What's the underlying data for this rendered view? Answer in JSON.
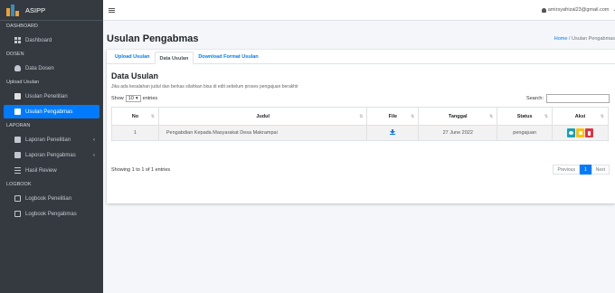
{
  "brand": {
    "name": "ASIPP"
  },
  "sidebar": {
    "sections": [
      {
        "header": "DASHBOARD",
        "items": [
          {
            "label": "Dashboard",
            "icon": "grid-icon"
          }
        ]
      },
      {
        "header": "DOSEN",
        "items": [
          {
            "label": "Data Dosen",
            "icon": "users-icon"
          }
        ]
      },
      {
        "header": "Upload Usulan",
        "items": [
          {
            "label": "Usulan Penelitian",
            "icon": "file-icon"
          },
          {
            "label": "Usulan Pengabmas",
            "icon": "file-icon",
            "active": true
          }
        ]
      },
      {
        "header": "LAPORAN",
        "items": [
          {
            "label": "Laporan Penelitian",
            "icon": "check-square-icon"
          },
          {
            "label": "Laporan Pengabmas",
            "icon": "check-square-icon"
          },
          {
            "label": "Hasil Review",
            "icon": "list-icon"
          }
        ]
      },
      {
        "header": "LOGBOOK",
        "items": [
          {
            "label": "Logbook Penelitian",
            "icon": "edit-icon"
          },
          {
            "label": "Logbook Pengabmas",
            "icon": "edit-icon"
          }
        ]
      }
    ]
  },
  "topbar": {
    "user_email": "amirsyafrizal23@gmail.com"
  },
  "page": {
    "title": "Usulan Pengabmas",
    "breadcrumb": {
      "home": "Home",
      "separator": "/",
      "current": "Usulan Pengabmas"
    }
  },
  "tabs": [
    {
      "label": "Upload Usulan",
      "active": false
    },
    {
      "label": "Data Usulan",
      "active": true
    },
    {
      "label": "Download Format Usulan",
      "active": false
    }
  ],
  "panel": {
    "title": "Data Usulan",
    "note": "Jika ada kesalahan judul dan berkas silahkan bisa di edit sebelum proses pengajuan berakhir",
    "show_prefix": "Show",
    "show_value": "10",
    "show_suffix": "entries",
    "search_label": "Search:",
    "search_value": ""
  },
  "table": {
    "columns": [
      "No",
      "Judul",
      "File",
      "Tanggal",
      "Status",
      "Aksi"
    ],
    "rows": [
      {
        "no": "1",
        "judul": "Pengabdian Kepada Masyarakat Desa Makrampai",
        "file_icon": "download-icon",
        "tanggal": "27 June 2022",
        "status": "pengajuan"
      }
    ],
    "info": "Showing 1 to 1 of 1 entries",
    "pagination": {
      "previous": "Previous",
      "current": "1",
      "next": "Next"
    }
  },
  "colors": {
    "sidebar_bg": "#343a40",
    "accent": "#007bff",
    "view_btn": "#17a2b8",
    "edit_btn": "#ffc107",
    "delete_btn": "#dc3545"
  }
}
